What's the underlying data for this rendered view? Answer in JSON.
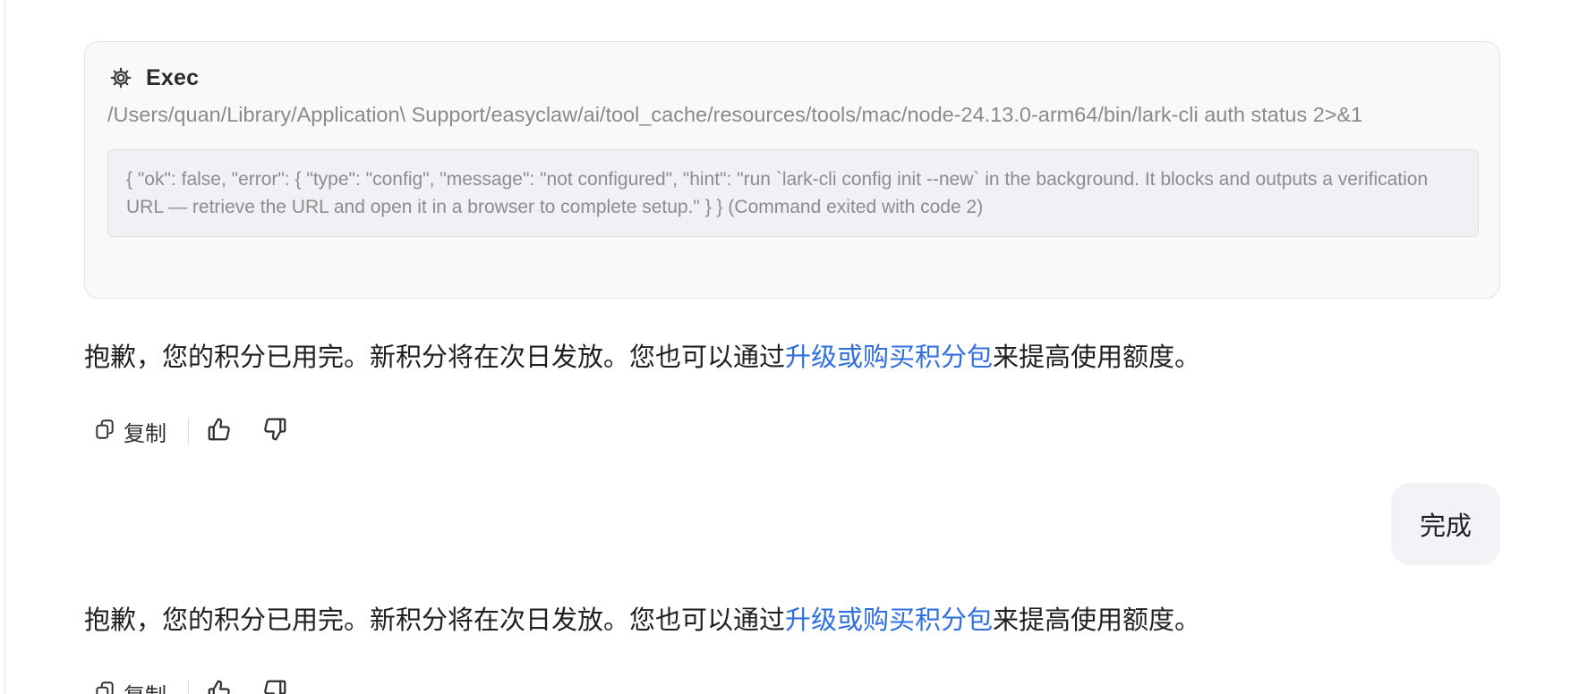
{
  "tool_card": {
    "icon": "gear-icon",
    "title": "Exec",
    "command": "/Users/quan/Library/Application\\ Support/easyclaw/ai/tool_cache/resources/tools/mac/node-24.13.0-arm64/bin/lark-cli auth status 2>&1",
    "output": "{ \"ok\": false, \"error\": { \"type\": \"config\", \"message\": \"not configured\", \"hint\": \"run `lark-cli config init --new` in the background. It blocks and outputs a verification URL — retrieve the URL and open it in a browser to complete setup.\" } } (Command exited with code 2)"
  },
  "messages": [
    {
      "text_before": "抱歉，您的积分已用完。新积分将在次日发放。您也可以通过",
      "link_text": "升级或购买积分包",
      "text_after": "来提高使用额度。"
    },
    {
      "text_before": "抱歉，您的积分已用完。新积分将在次日发放。您也可以通过",
      "link_text": "升级或购买积分包",
      "text_after": "来提高使用额度。"
    }
  ],
  "actions": {
    "copy_label": "复制",
    "copy_icon": "copy-icon",
    "like_icon": "thumbs-up-icon",
    "dislike_icon": "thumbs-down-icon"
  },
  "user_message": "完成",
  "colors": {
    "link": "#2f6fe0",
    "card_bg": "#f9f9f9",
    "output_bg": "#f0f1f4",
    "bubble_bg": "#f2f3f6"
  }
}
